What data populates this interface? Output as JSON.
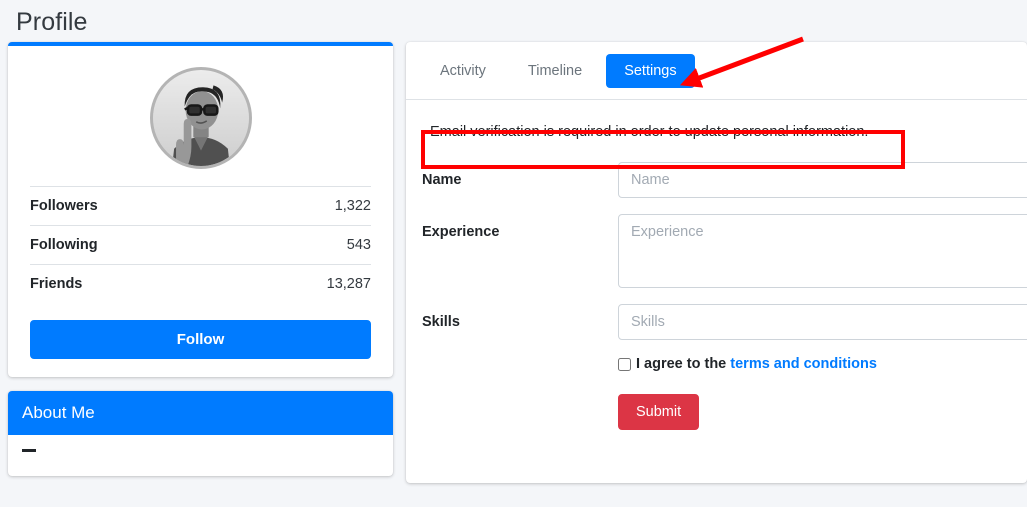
{
  "header": {
    "title": "Profile"
  },
  "profile_card": {
    "avatar": {
      "icon": "user-photo-avatar",
      "alt": "Profile photo"
    },
    "stats": [
      {
        "label": "Followers",
        "value": "1,322"
      },
      {
        "label": "Following",
        "value": "543"
      },
      {
        "label": "Friends",
        "value": "13,287"
      }
    ],
    "follow_label": "Follow"
  },
  "about_card": {
    "title": "About Me",
    "first_item_icon": "book-icon"
  },
  "settings_card": {
    "tabs": [
      {
        "label": "Activity",
        "active": false
      },
      {
        "label": "Timeline",
        "active": false
      },
      {
        "label": "Settings",
        "active": true
      }
    ],
    "notice": "Email verification is required in order to update personal information.",
    "form": {
      "fields": [
        {
          "label": "Name",
          "placeholder": "Name",
          "value": "",
          "type": "text"
        },
        {
          "label": "Experience",
          "placeholder": "Experience",
          "value": "",
          "type": "textarea"
        },
        {
          "label": "Skills",
          "placeholder": "Skills",
          "value": "",
          "type": "text"
        }
      ],
      "agree_text": "I agree to the",
      "terms_link_text": "terms and conditions",
      "agree_checked": false,
      "submit_label": "Submit"
    }
  },
  "annotations": {
    "highlight_box_color": "#ff0000",
    "arrow_color": "#ff0000",
    "arrow_target": "settings-tab"
  },
  "colors": {
    "page_background": "#f4f6f9",
    "accent_blue": "#007bff",
    "submit_red": "#dc3545",
    "annotation_red": "#ff0000",
    "muted_text": "#6c757d"
  }
}
